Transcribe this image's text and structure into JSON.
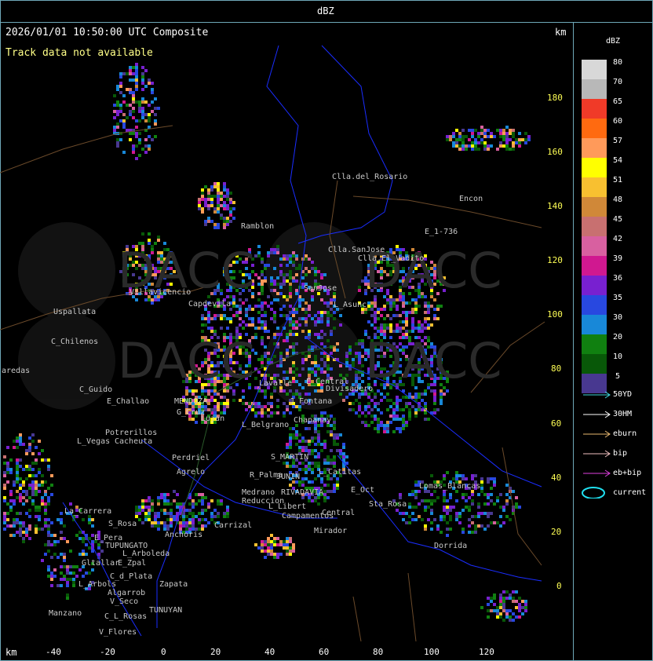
{
  "header": {
    "title": "dBZ"
  },
  "map": {
    "timestamp": "2026/01/01 10:50:00 UTC Composite",
    "status": "Track data not available",
    "unit_top": "km",
    "unit_bottom": "km",
    "x_ticks": [
      "-40",
      "-20",
      "0",
      "20",
      "40",
      "60",
      "80",
      "100",
      "120"
    ],
    "y_ticks": [
      "180",
      "160",
      "140",
      "120",
      "100",
      "80",
      "60",
      "40",
      "20",
      "0"
    ],
    "watermark": "DACC",
    "places": [
      "Clla.del_Rosario",
      "Encon",
      "E_1-736",
      "Ramblon",
      "Clla.SanJose",
      "Clla.El_Vadito",
      "Uspallata",
      "Villavicencio",
      "Capdevila",
      "SanJose",
      "L_Asunc",
      "C_Chilenos",
      "aredas",
      "C_Guido",
      "E_Challao",
      "MENDOZA",
      "G_Cruz",
      "Lujan",
      "Lavalle",
      "Divisadero",
      "E_Central",
      "J_Fontana",
      "Potrerillos",
      "L_Vegas",
      "Cacheuta",
      "L_Belgrano",
      "Chapanay",
      "Perdriel",
      "Agrelo",
      "S_MARTIN",
      "JUNIN",
      "R_Palma",
      "Medrano",
      "Reduccion",
      "RIVADAVIA",
      "L_Catitas",
      "Lomas_Blancas",
      "La_Carrera",
      "Carrizal",
      "Anchoris",
      "E_Pera",
      "TUPUNGATO",
      "L_Arboleda",
      "Gltallar",
      "E_Zpal",
      "L_Arbols",
      "C_d_Plata",
      "Zapata",
      "Algarrob",
      "V_Seco",
      "Manzano",
      "TUNUYAN",
      "C_L_Rosas",
      "V_Flores",
      "Campamentos",
      "Mirador",
      "L_Libert",
      "Central",
      "Dorrida",
      "S_Rosa",
      "E_Oct",
      "Sta_Rosa"
    ]
  },
  "legend": {
    "title": "dBZ",
    "levels": [
      {
        "label": "80",
        "color": "#d8d8d8"
      },
      {
        "label": "70",
        "color": "#b8b8b8"
      },
      {
        "label": "65",
        "color": "#f03a28"
      },
      {
        "label": "60",
        "color": "#ff6a10"
      },
      {
        "label": "57",
        "color": "#ff9a5a"
      },
      {
        "label": "54",
        "color": "#ffff00"
      },
      {
        "label": "51",
        "color": "#f8c030"
      },
      {
        "label": "48",
        "color": "#d08838"
      },
      {
        "label": "45",
        "color": "#c87070"
      },
      {
        "label": "42",
        "color": "#d860a0"
      },
      {
        "label": "39",
        "color": "#d01890"
      },
      {
        "label": "36",
        "color": "#7820d0"
      },
      {
        "label": "35",
        "color": "#2848e0"
      },
      {
        "label": "30",
        "color": "#1888d8"
      },
      {
        "label": "20",
        "color": "#108010"
      },
      {
        "label": "10",
        "color": "#085808"
      },
      {
        "label": "5",
        "color": "#483890"
      }
    ],
    "tracks": [
      {
        "label": "50YD",
        "color": "#40d8e0"
      },
      {
        "label": "30HM",
        "color": "#ffffff"
      },
      {
        "label": "eburn",
        "color": "#e8b870"
      },
      {
        "label": "bip",
        "color": "#f0c0c0"
      },
      {
        "label": "eb+bip",
        "color": "#e040e0"
      }
    ],
    "current": {
      "label": "current",
      "color": "#20e0f0"
    }
  }
}
